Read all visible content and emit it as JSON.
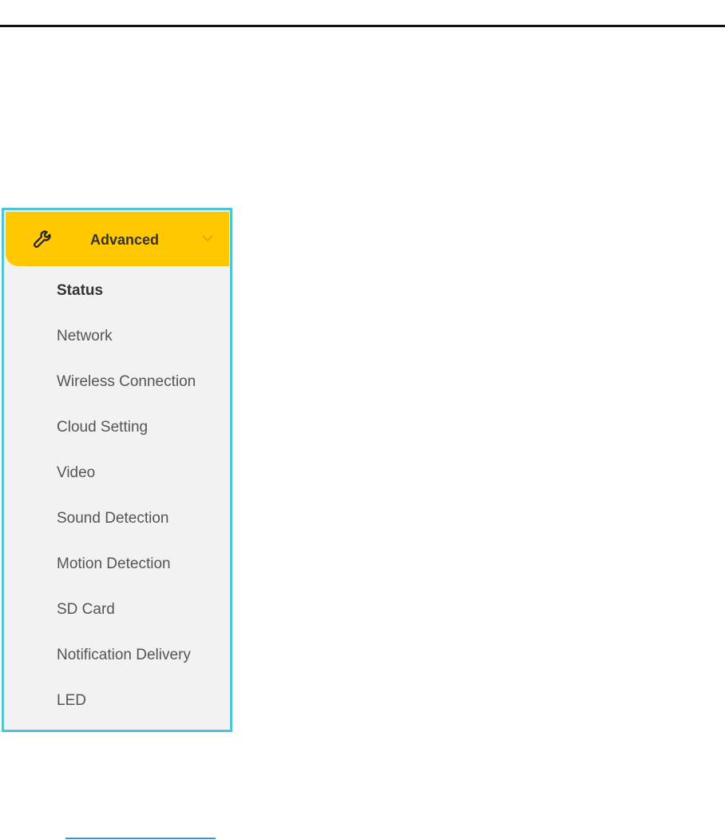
{
  "menu": {
    "header_label": "Advanced",
    "accent_color": "#ffc800",
    "border_color": "#4dc7d3",
    "header_icon": "wrench-icon",
    "expand_icon": "chevron-down-icon",
    "active_item": "Status",
    "items": [
      {
        "label": "Status"
      },
      {
        "label": "Network"
      },
      {
        "label": "Wireless Connection"
      },
      {
        "label": "Cloud Setting"
      },
      {
        "label": "Video"
      },
      {
        "label": "Sound Detection"
      },
      {
        "label": "Motion Detection"
      },
      {
        "label": "SD Card"
      },
      {
        "label": "Notification Delivery"
      },
      {
        "label": "LED"
      }
    ]
  }
}
